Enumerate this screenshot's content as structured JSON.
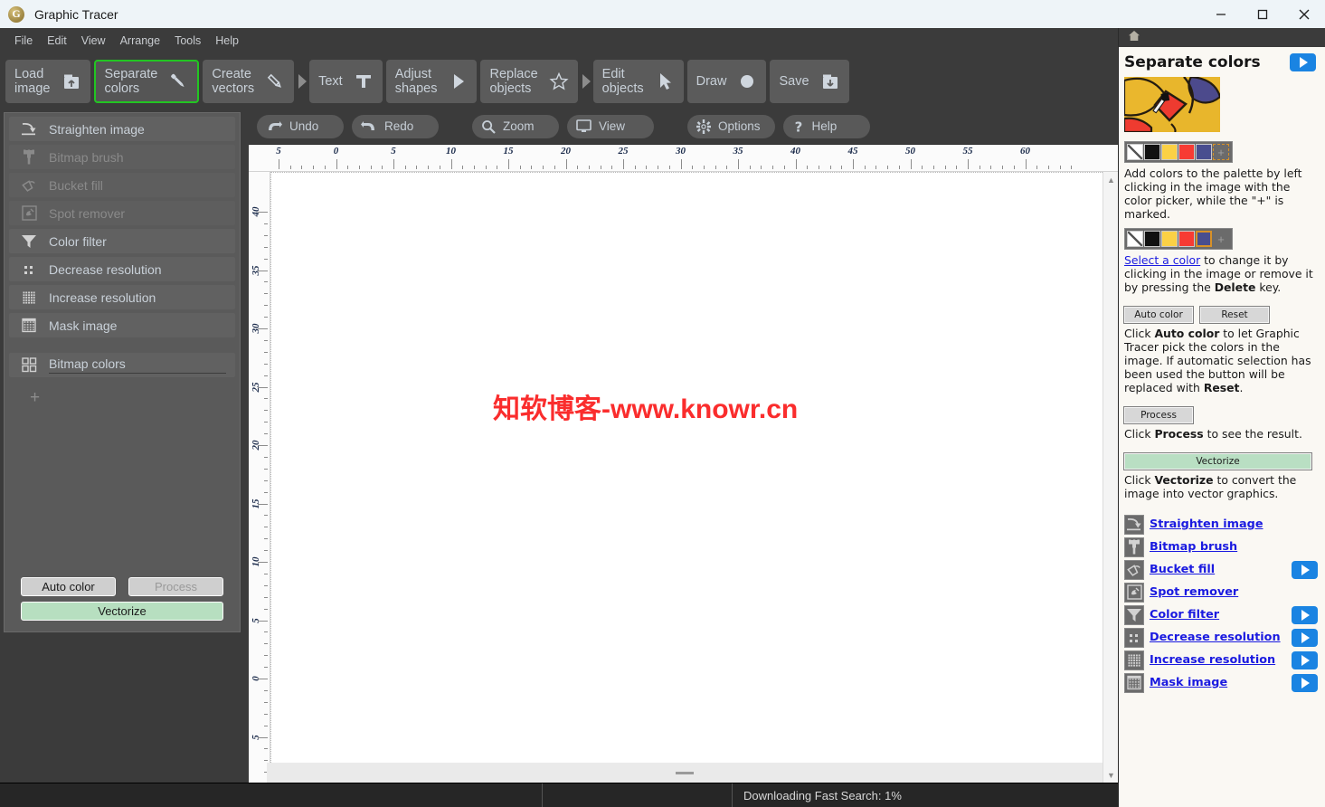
{
  "window": {
    "title": "Graphic Tracer",
    "logo_letter": "G",
    "minimize_label": "Minimize",
    "maximize_label": "Maximize",
    "close_label": "Close"
  },
  "menubar": {
    "items": [
      "File",
      "Edit",
      "View",
      "Arrange",
      "Tools",
      "Help"
    ]
  },
  "toolbar": {
    "buttons": [
      {
        "label": "Load\nimage",
        "icon": "load-image-icon",
        "active": false,
        "caret": false
      },
      {
        "label": "Separate\ncolors",
        "icon": "eyedropper-icon",
        "active": true,
        "caret": false
      },
      {
        "label": "Create\nvectors",
        "icon": "pencil-icon",
        "active": false,
        "caret": true
      },
      {
        "label": "Text",
        "icon": "text-t-icon",
        "active": false,
        "caret": false
      },
      {
        "label": "Adjust\nshapes",
        "icon": "triangle-right-icon",
        "active": false,
        "caret": false
      },
      {
        "label": "Replace\nobjects",
        "icon": "star-outline-icon",
        "active": false,
        "caret": true
      },
      {
        "label": "Edit\nobjects",
        "icon": "arrow-cursor-icon",
        "active": false,
        "caret": false
      },
      {
        "label": "Draw",
        "icon": "circle-filled-icon",
        "active": false,
        "caret": false
      },
      {
        "label": "Save",
        "icon": "save-box-icon",
        "active": false,
        "caret": false
      }
    ]
  },
  "subtoolbar": {
    "buttons": [
      {
        "label": "Undo",
        "icon": "undo-arrow-icon"
      },
      {
        "label": "Redo",
        "icon": "redo-arrow-icon"
      },
      {
        "label": "Zoom",
        "icon": "magnifier-icon"
      },
      {
        "label": "View",
        "icon": "monitor-icon"
      },
      {
        "label": "Options",
        "icon": "gear-icon"
      },
      {
        "label": "Help",
        "icon": "question-mark-icon"
      }
    ]
  },
  "left_panel": {
    "tools": [
      {
        "label": "Straighten image",
        "icon": "straighten-image-icon",
        "disabled": false
      },
      {
        "label": "Bitmap brush",
        "icon": "bitmap-brush-icon",
        "disabled": true
      },
      {
        "label": "Bucket fill",
        "icon": "bucket-fill-icon",
        "disabled": true
      },
      {
        "label": "Spot remover",
        "icon": "spot-remover-icon",
        "disabled": true
      },
      {
        "label": "Color filter",
        "icon": "funnel-icon",
        "disabled": false
      },
      {
        "label": "Decrease resolution",
        "icon": "decrease-resolution-icon",
        "disabled": false
      },
      {
        "label": "Increase resolution",
        "icon": "increase-resolution-icon",
        "disabled": false
      },
      {
        "label": "Mask image",
        "icon": "mask-image-icon",
        "disabled": false
      }
    ],
    "section_header": {
      "label": "Bitmap colors",
      "icon": "bitmap-colors-icon"
    },
    "add_color_glyph": "+",
    "buttons": {
      "auto_color": "Auto color",
      "process": "Process",
      "process_disabled": true,
      "vectorize": "Vectorize"
    }
  },
  "canvas": {
    "ruler_h_labels": [
      "5",
      "0",
      "5",
      "10",
      "15",
      "20",
      "25",
      "30",
      "35",
      "40",
      "45",
      "50",
      "55",
      "60"
    ],
    "ruler_v_labels": [
      "40",
      "35",
      "30",
      "25",
      "20",
      "15",
      "10",
      "5",
      "0",
      "5"
    ],
    "watermark": "知软博客-www.knowr.cn",
    "watermark_color": "#fa2d2d"
  },
  "right_panel": {
    "home_icon": "home-icon",
    "title": "Separate colors",
    "play_label": "play-video",
    "thumbnail_alt": "image-preview-thumbnail",
    "palette_1": {
      "swatches": [
        "none",
        "#111111",
        "#fbd145",
        "#f73b33",
        "#494e8f"
      ],
      "plus_glyph": "+",
      "plus_marked": true
    },
    "palette_1_text_parts": {
      "p1": "Add colors to the palette by left clicking in the image with the color picker, while the \"+\" is marked."
    },
    "palette_2": {
      "swatches": [
        "none",
        "#111111",
        "#fbd145",
        "#f73b33",
        "#494e8f"
      ],
      "selected_index": 4,
      "plus_glyph": "+",
      "plus_marked": false
    },
    "palette_2_text_parts": {
      "link": "Select a color",
      "after": " to change it by clicking in the image or remove it by pressing the ",
      "bold": "Delete",
      "tail": " key."
    },
    "buttons_row": {
      "auto_color": "Auto color",
      "reset": "Reset"
    },
    "auto_color_text_parts": {
      "p1": "Click ",
      "b1": "Auto color",
      "p2": " to let Graphic Tracer pick the colors in the image. If automatic selection has been used the button will be replaced with ",
      "b2": "Reset",
      "p3": "."
    },
    "process_button": "Process",
    "process_text_parts": {
      "p1": "Click ",
      "b1": "Process",
      "p2": " to see the result."
    },
    "vectorize_button": "Vectorize",
    "vectorize_text_parts": {
      "p1": "Click ",
      "b1": "Vectorize",
      "p2": " to convert the image into vector graphics."
    },
    "links": [
      {
        "label": "Straighten image",
        "icon": "straighten-image-icon",
        "has_video": false
      },
      {
        "label": "Bitmap brush",
        "icon": "bitmap-brush-icon",
        "has_video": false
      },
      {
        "label": "Bucket fill",
        "icon": "bucket-fill-icon",
        "has_video": true
      },
      {
        "label": "Spot remover",
        "icon": "spot-remover-icon",
        "has_video": false
      },
      {
        "label": "Color filter",
        "icon": "funnel-icon",
        "has_video": true
      },
      {
        "label": "Decrease resolution",
        "icon": "decrease-resolution-icon",
        "has_video": true
      },
      {
        "label": "Increase resolution",
        "icon": "increase-resolution-icon",
        "has_video": true
      },
      {
        "label": "Mask image",
        "icon": "mask-image-icon",
        "has_video": true
      }
    ]
  },
  "statusbar": {
    "cell1": "",
    "cell2": "",
    "message": "Downloading Fast Search: 1%"
  }
}
